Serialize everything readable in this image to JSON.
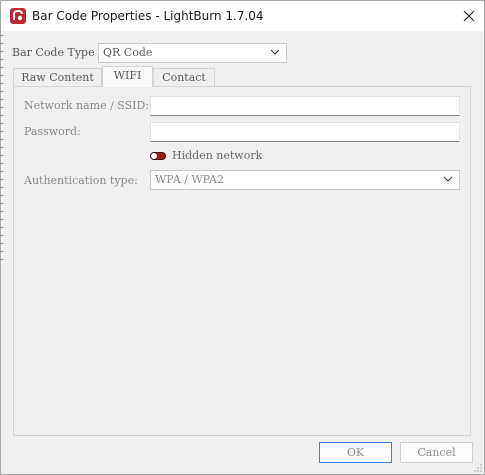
{
  "window": {
    "title": "Bar Code Properties - LightBurn 1.7.04"
  },
  "barcode_type": {
    "label": "Bar Code Type",
    "value": "QR Code"
  },
  "tabs": [
    {
      "label": "Raw Content",
      "active": false
    },
    {
      "label": "WIFI",
      "active": true
    },
    {
      "label": "Contact",
      "active": false
    }
  ],
  "wifi": {
    "ssid_label": "Network name / SSID:",
    "ssid_value": "",
    "password_label": "Password:",
    "password_value": "",
    "hidden_label": "Hidden network",
    "auth_label": "Authentication type:",
    "auth_value": "WPA / WPA2"
  },
  "buttons": {
    "ok": "OK",
    "cancel": "Cancel"
  },
  "colors": {
    "toggle": "#a11a1a",
    "ok_border": "#3c7fd6"
  },
  "icons": [
    "lightburn-app-icon",
    "close-icon",
    "chevron-down-icon",
    "resize-grip-icon"
  ]
}
